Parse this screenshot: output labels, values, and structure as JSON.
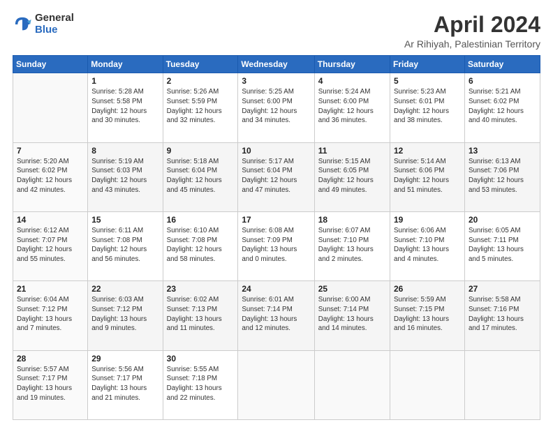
{
  "header": {
    "logo_line1": "General",
    "logo_line2": "Blue",
    "month": "April 2024",
    "location": "Ar Rihiyah, Palestinian Territory"
  },
  "weekdays": [
    "Sunday",
    "Monday",
    "Tuesday",
    "Wednesday",
    "Thursday",
    "Friday",
    "Saturday"
  ],
  "weeks": [
    [
      {
        "day": "",
        "info": ""
      },
      {
        "day": "1",
        "info": "Sunrise: 5:28 AM\nSunset: 5:58 PM\nDaylight: 12 hours\nand 30 minutes."
      },
      {
        "day": "2",
        "info": "Sunrise: 5:26 AM\nSunset: 5:59 PM\nDaylight: 12 hours\nand 32 minutes."
      },
      {
        "day": "3",
        "info": "Sunrise: 5:25 AM\nSunset: 6:00 PM\nDaylight: 12 hours\nand 34 minutes."
      },
      {
        "day": "4",
        "info": "Sunrise: 5:24 AM\nSunset: 6:00 PM\nDaylight: 12 hours\nand 36 minutes."
      },
      {
        "day": "5",
        "info": "Sunrise: 5:23 AM\nSunset: 6:01 PM\nDaylight: 12 hours\nand 38 minutes."
      },
      {
        "day": "6",
        "info": "Sunrise: 5:21 AM\nSunset: 6:02 PM\nDaylight: 12 hours\nand 40 minutes."
      }
    ],
    [
      {
        "day": "7",
        "info": "Sunrise: 5:20 AM\nSunset: 6:02 PM\nDaylight: 12 hours\nand 42 minutes."
      },
      {
        "day": "8",
        "info": "Sunrise: 5:19 AM\nSunset: 6:03 PM\nDaylight: 12 hours\nand 43 minutes."
      },
      {
        "day": "9",
        "info": "Sunrise: 5:18 AM\nSunset: 6:04 PM\nDaylight: 12 hours\nand 45 minutes."
      },
      {
        "day": "10",
        "info": "Sunrise: 5:17 AM\nSunset: 6:04 PM\nDaylight: 12 hours\nand 47 minutes."
      },
      {
        "day": "11",
        "info": "Sunrise: 5:15 AM\nSunset: 6:05 PM\nDaylight: 12 hours\nand 49 minutes."
      },
      {
        "day": "12",
        "info": "Sunrise: 5:14 AM\nSunset: 6:06 PM\nDaylight: 12 hours\nand 51 minutes."
      },
      {
        "day": "13",
        "info": "Sunrise: 6:13 AM\nSunset: 7:06 PM\nDaylight: 12 hours\nand 53 minutes."
      }
    ],
    [
      {
        "day": "14",
        "info": "Sunrise: 6:12 AM\nSunset: 7:07 PM\nDaylight: 12 hours\nand 55 minutes."
      },
      {
        "day": "15",
        "info": "Sunrise: 6:11 AM\nSunset: 7:08 PM\nDaylight: 12 hours\nand 56 minutes."
      },
      {
        "day": "16",
        "info": "Sunrise: 6:10 AM\nSunset: 7:08 PM\nDaylight: 12 hours\nand 58 minutes."
      },
      {
        "day": "17",
        "info": "Sunrise: 6:08 AM\nSunset: 7:09 PM\nDaylight: 13 hours\nand 0 minutes."
      },
      {
        "day": "18",
        "info": "Sunrise: 6:07 AM\nSunset: 7:10 PM\nDaylight: 13 hours\nand 2 minutes."
      },
      {
        "day": "19",
        "info": "Sunrise: 6:06 AM\nSunset: 7:10 PM\nDaylight: 13 hours\nand 4 minutes."
      },
      {
        "day": "20",
        "info": "Sunrise: 6:05 AM\nSunset: 7:11 PM\nDaylight: 13 hours\nand 5 minutes."
      }
    ],
    [
      {
        "day": "21",
        "info": "Sunrise: 6:04 AM\nSunset: 7:12 PM\nDaylight: 13 hours\nand 7 minutes."
      },
      {
        "day": "22",
        "info": "Sunrise: 6:03 AM\nSunset: 7:12 PM\nDaylight: 13 hours\nand 9 minutes."
      },
      {
        "day": "23",
        "info": "Sunrise: 6:02 AM\nSunset: 7:13 PM\nDaylight: 13 hours\nand 11 minutes."
      },
      {
        "day": "24",
        "info": "Sunrise: 6:01 AM\nSunset: 7:14 PM\nDaylight: 13 hours\nand 12 minutes."
      },
      {
        "day": "25",
        "info": "Sunrise: 6:00 AM\nSunset: 7:14 PM\nDaylight: 13 hours\nand 14 minutes."
      },
      {
        "day": "26",
        "info": "Sunrise: 5:59 AM\nSunset: 7:15 PM\nDaylight: 13 hours\nand 16 minutes."
      },
      {
        "day": "27",
        "info": "Sunrise: 5:58 AM\nSunset: 7:16 PM\nDaylight: 13 hours\nand 17 minutes."
      }
    ],
    [
      {
        "day": "28",
        "info": "Sunrise: 5:57 AM\nSunset: 7:17 PM\nDaylight: 13 hours\nand 19 minutes."
      },
      {
        "day": "29",
        "info": "Sunrise: 5:56 AM\nSunset: 7:17 PM\nDaylight: 13 hours\nand 21 minutes."
      },
      {
        "day": "30",
        "info": "Sunrise: 5:55 AM\nSunset: 7:18 PM\nDaylight: 13 hours\nand 22 minutes."
      },
      {
        "day": "",
        "info": ""
      },
      {
        "day": "",
        "info": ""
      },
      {
        "day": "",
        "info": ""
      },
      {
        "day": "",
        "info": ""
      }
    ]
  ]
}
